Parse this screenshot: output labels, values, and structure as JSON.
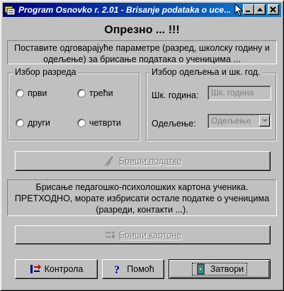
{
  "window": {
    "title": "Program Osnovko  r. 2.01 - Brisanje podataka o uce...",
    "colors": {
      "titlebar_start": "#000080",
      "titlebar_end": "#1084d0",
      "face": "#c0c0c0"
    }
  },
  "main": {
    "heading": "Опрезно ... !!!",
    "instruction": "Поставите одговарајуће параметре (разред, школску годину и одељење) за брисање података о ученицима ..."
  },
  "grade_group": {
    "legend": "Избор разреда",
    "options": [
      {
        "label": "први"
      },
      {
        "label": "трећи"
      },
      {
        "label": "други"
      },
      {
        "label": "четврти"
      }
    ]
  },
  "class_group": {
    "legend": "Избор одељења и шк. год.",
    "school_year_label": "Шк. година:",
    "school_year_value": "Шк. година",
    "section_label": "Одељење:",
    "section_value": "Одељење"
  },
  "delete_data_button": {
    "label": "Бриши податке",
    "icon": "broom-icon"
  },
  "psych_info": "Брисање педагошко-психолошких картона ученика. ПРЕТХОДНО, морате избрисати остале податке о ученицима (разреди, контакти ...).",
  "delete_cards_button": {
    "label": "Бриши картоне",
    "icon": "delete-cards-icon"
  },
  "footer": {
    "control_label": "Контрола",
    "help_label": "Помоћ",
    "close_label": "Затвори"
  }
}
